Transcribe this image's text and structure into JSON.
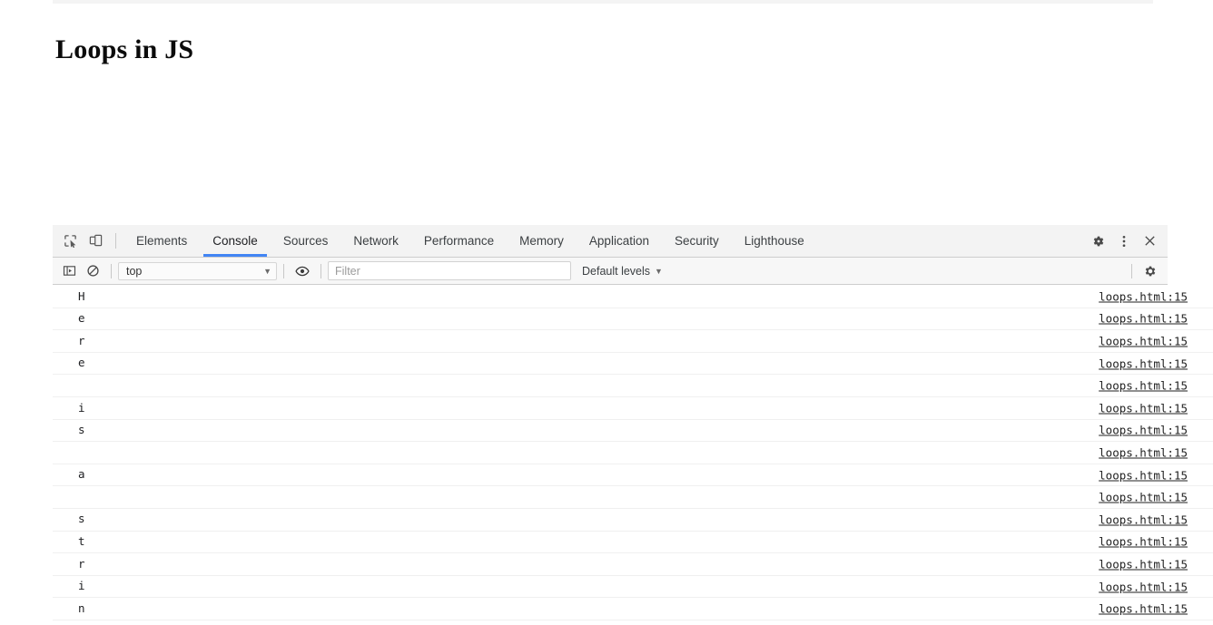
{
  "page": {
    "title": "Loops in JS"
  },
  "devtools": {
    "toolbar": {
      "inspect_icon": "inspect-element-icon",
      "device_icon": "device-toolbar-icon",
      "tabs": [
        {
          "label": "Elements",
          "active": false
        },
        {
          "label": "Console",
          "active": true
        },
        {
          "label": "Sources",
          "active": false
        },
        {
          "label": "Network",
          "active": false
        },
        {
          "label": "Performance",
          "active": false
        },
        {
          "label": "Memory",
          "active": false
        },
        {
          "label": "Application",
          "active": false
        },
        {
          "label": "Security",
          "active": false
        },
        {
          "label": "Lighthouse",
          "active": false
        }
      ],
      "settings_icon": "gear-icon",
      "more_icon": "kebab-menu-icon",
      "close_icon": "close-icon",
      "active_tab_underline_color": "#4285f4"
    },
    "filterbar": {
      "sidebar_icon": "console-sidebar-toggle-icon",
      "clear_icon": "clear-console-icon",
      "context_value": "top",
      "eye_icon": "live-expression-eye-icon",
      "filter_placeholder": "Filter",
      "filter_value": "",
      "levels_label": "Default levels",
      "settings_icon": "gear-icon",
      "caret": "▾"
    },
    "console": {
      "messages": [
        {
          "text": "H",
          "source": "loops.html:15"
        },
        {
          "text": "e",
          "source": "loops.html:15"
        },
        {
          "text": "r",
          "source": "loops.html:15"
        },
        {
          "text": "e",
          "source": "loops.html:15"
        },
        {
          "text": " ",
          "source": "loops.html:15"
        },
        {
          "text": "i",
          "source": "loops.html:15"
        },
        {
          "text": "s",
          "source": "loops.html:15"
        },
        {
          "text": " ",
          "source": "loops.html:15"
        },
        {
          "text": "a",
          "source": "loops.html:15"
        },
        {
          "text": " ",
          "source": "loops.html:15"
        },
        {
          "text": "s",
          "source": "loops.html:15"
        },
        {
          "text": "t",
          "source": "loops.html:15"
        },
        {
          "text": "r",
          "source": "loops.html:15"
        },
        {
          "text": "i",
          "source": "loops.html:15"
        },
        {
          "text": "n",
          "source": "loops.html:15"
        }
      ]
    }
  }
}
